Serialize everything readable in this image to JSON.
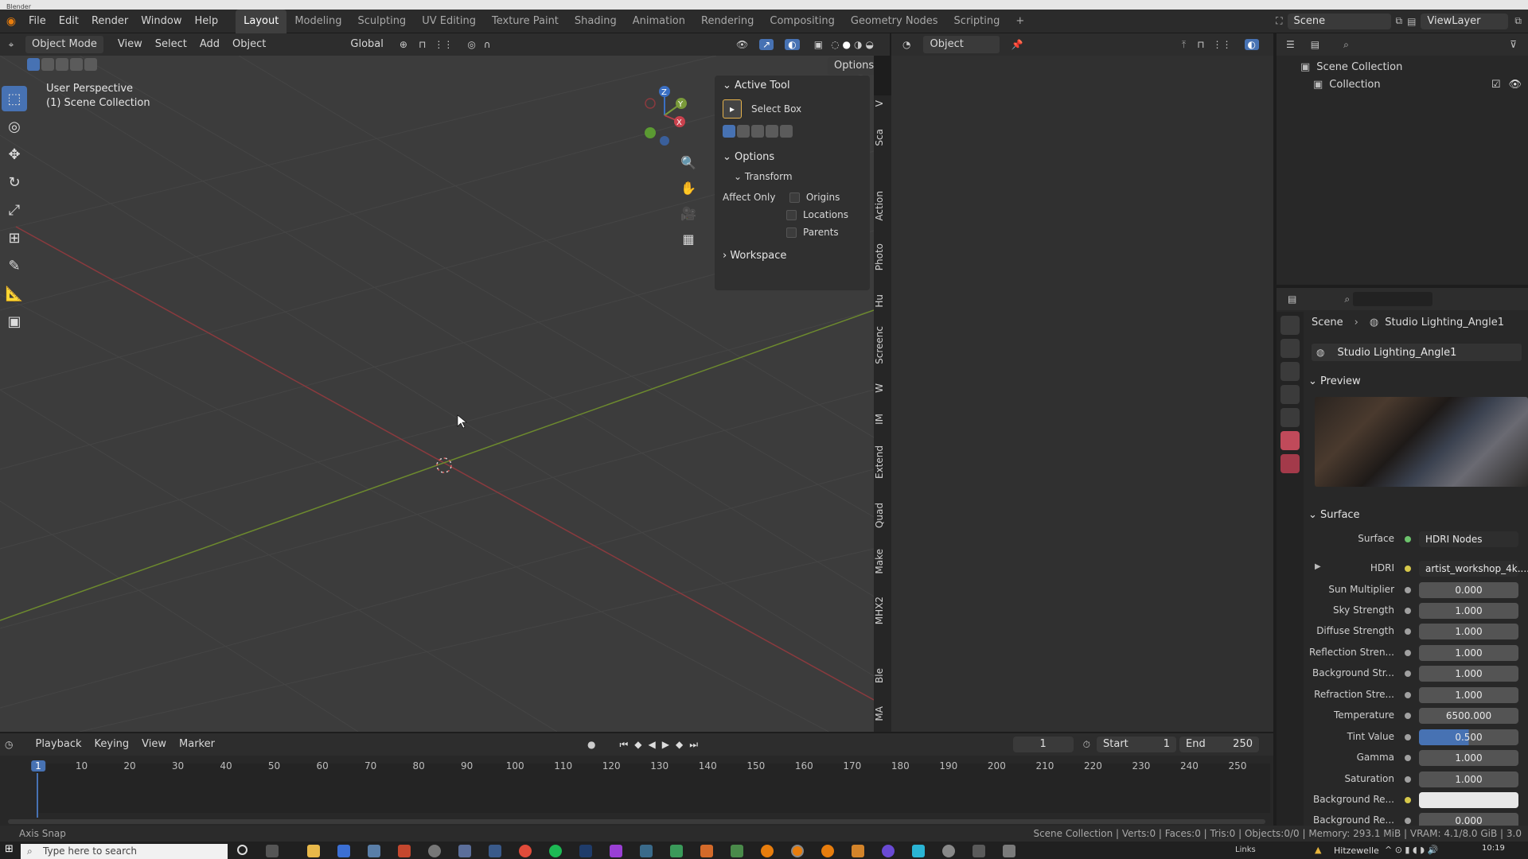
{
  "app": {
    "window_title": "Blender"
  },
  "menu": [
    "File",
    "Edit",
    "Render",
    "Window",
    "Help"
  ],
  "workspaces": {
    "tabs": [
      "Layout",
      "Modeling",
      "Sculpting",
      "UV Editing",
      "Texture Paint",
      "Shading",
      "Animation",
      "Rendering",
      "Compositing",
      "Geometry Nodes",
      "Scripting"
    ],
    "active": "Layout",
    "add": "+"
  },
  "scene": {
    "name": "Scene",
    "view_layer": "ViewLayer"
  },
  "viewport_header": {
    "mode": "Object Mode",
    "view": "View",
    "select": "Select",
    "add": "Add",
    "object": "Object",
    "transform_orientation": "Global",
    "options": "Options",
    "object_dropdown": "Object"
  },
  "viewport": {
    "perspective": "User Perspective",
    "collection": "(1) Scene Collection"
  },
  "gizmo": {
    "x": "X",
    "y": "Y",
    "z": "Z"
  },
  "npanel": {
    "active_tool": "Active Tool",
    "tool_name": "Select Box",
    "options": "Options",
    "transform": "Transform",
    "affect_only": "Affect Only",
    "origins": "Origins",
    "locations": "Locations",
    "parents": "Parents",
    "workspace": "Workspace"
  },
  "side_tabs": [
    "V",
    "Sca",
    "Action",
    "Photo",
    "Hu",
    "Screenc",
    "W",
    "IM",
    "Extend",
    "Quad",
    "Make",
    "MHX2",
    "Ble",
    "MA"
  ],
  "outliner": {
    "root": "Scene Collection",
    "child": "Collection"
  },
  "properties": {
    "breadcrumb_scene": "Scene",
    "breadcrumb_world": "Studio Lighting_Angle1",
    "world_name": "Studio Lighting_Angle1",
    "preview": "Preview",
    "surface_section": "Surface",
    "rows": [
      {
        "label": "Surface",
        "value": "HDRI Nodes"
      },
      {
        "label": "HDRI",
        "value": "artist_workshop_4k...."
      },
      {
        "label": "Sun Multiplier",
        "value": "0.000"
      },
      {
        "label": "Sky Strength",
        "value": "1.000"
      },
      {
        "label": "Diffuse Strength",
        "value": "1.000"
      },
      {
        "label": "Reflection Stren...",
        "value": "1.000"
      },
      {
        "label": "Background Str...",
        "value": "1.000"
      },
      {
        "label": "Refraction Stre...",
        "value": "1.000"
      },
      {
        "label": "Temperature",
        "value": "6500.000"
      },
      {
        "label": "Tint Value",
        "value": "0.500"
      },
      {
        "label": "Gamma",
        "value": "1.000"
      },
      {
        "label": "Saturation",
        "value": "1.000"
      },
      {
        "label": "Background Re...",
        "value": ""
      },
      {
        "label": "Background Re...",
        "value": "0.000"
      }
    ]
  },
  "timeline": {
    "playback": "Playback",
    "keying": "Keying",
    "view": "View",
    "marker": "Marker",
    "current_frame": "1",
    "start_label": "Start",
    "start": "1",
    "end_label": "End",
    "end": "250",
    "ticks": [
      "1",
      "10",
      "20",
      "30",
      "40",
      "50",
      "60",
      "70",
      "80",
      "90",
      "100",
      "110",
      "120",
      "130",
      "140",
      "150",
      "160",
      "170",
      "180",
      "190",
      "200",
      "210",
      "220",
      "230",
      "240",
      "250"
    ]
  },
  "status": {
    "left": "Axis Snap",
    "right": "Scene Collection | Verts:0 | Faces:0 | Tris:0 | Objects:0/0 | Memory: 293.1 MiB | VRAM: 4.1/8.0 GiB | 3.0"
  },
  "taskbar": {
    "search_placeholder": "Type here to search",
    "weather": "Hitzewelle",
    "links": "Links",
    "time": "10:19"
  },
  "colors": {
    "accent": "#4772b3",
    "x_axis": "#b0414b",
    "y_axis": "#7a9a3a",
    "z_axis": "#3a6fc4"
  }
}
